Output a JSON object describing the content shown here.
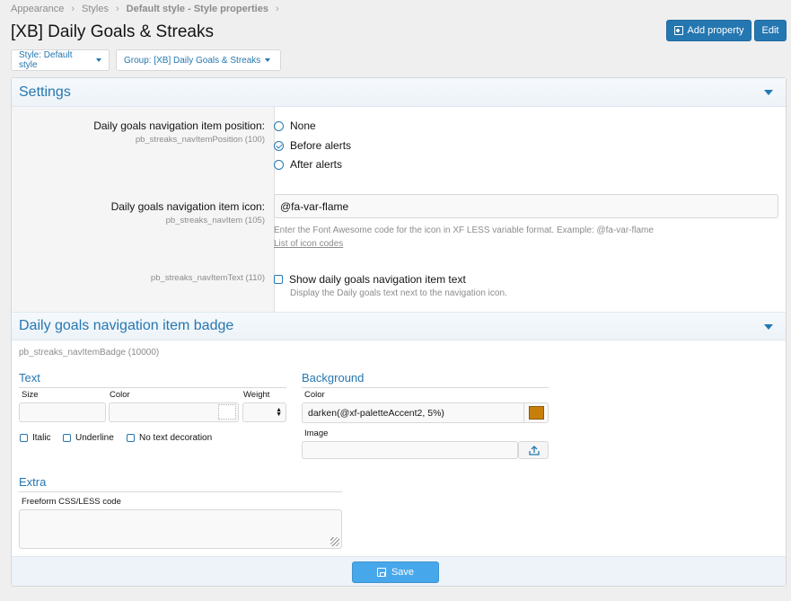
{
  "breadcrumb": [
    "Appearance",
    "Styles",
    "Default style - Style properties"
  ],
  "page_title": "[XB] Daily Goals & Streaks",
  "header_buttons": {
    "add_property": "Add property",
    "edit": "Edit"
  },
  "filters": {
    "style": "Style: Default style",
    "group": "Group: [XB] Daily Goals & Streaks"
  },
  "settings": {
    "title": "Settings",
    "position": {
      "label": "Daily goals navigation item position:",
      "key": "pb_streaks_navItemPosition (100)",
      "options": [
        "None",
        "Before alerts",
        "After alerts"
      ],
      "selected": "Before alerts"
    },
    "icon": {
      "label": "Daily goals navigation item icon:",
      "key": "pb_streaks_navItem (105)",
      "value": "@fa-var-flame",
      "explain": "Enter the Font Awesome code for the icon in XF LESS variable format. Example: @fa-var-flame",
      "link": "List of icon codes"
    },
    "text": {
      "key": "pb_streaks_navItemText (110)",
      "checkbox_label": "Show daily goals navigation item text",
      "hint": "Display the Daily goals text next to the navigation icon."
    }
  },
  "badge": {
    "title": "Daily goals navigation item badge",
    "key": "pb_streaks_navItemBadge (10000)",
    "text_group": {
      "title": "Text",
      "size_label": "Size",
      "color_label": "Color",
      "weight_label": "Weight",
      "italic": "Italic",
      "underline": "Underline",
      "no_decoration": "No text decoration"
    },
    "background_group": {
      "title": "Background",
      "color_label": "Color",
      "color_value": "darken(@xf-paletteAccent2, 5%)",
      "swatch_color": "#c87f0a",
      "image_label": "Image"
    },
    "extra_group": {
      "title": "Extra",
      "css_label": "Freeform CSS/LESS code"
    }
  },
  "save_label": "Save"
}
